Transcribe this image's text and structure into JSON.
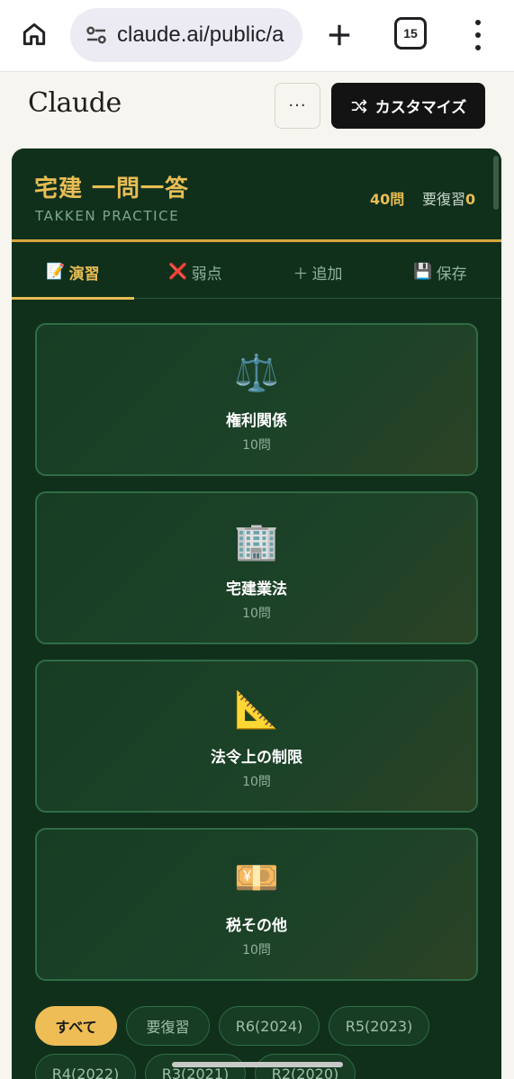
{
  "browser": {
    "url": "claude.ai/public/a",
    "tab_count": "15"
  },
  "claude": {
    "logo": "Claude",
    "more_label": "···",
    "customize_label": "カスタマイズ"
  },
  "app": {
    "title": "宅建 一問一答",
    "subtitle": "TAKKEN PRACTICE",
    "question_count": "40問",
    "review_label": "要復習",
    "review_count": "0",
    "tabs": [
      {
        "icon": "📝",
        "label": "演習"
      },
      {
        "icon": "❌",
        "label": "弱点"
      },
      {
        "icon": "＋",
        "label": "追加"
      },
      {
        "icon": "💾",
        "label": "保存"
      }
    ],
    "categories": [
      {
        "icon": "⚖️",
        "name": "権利関係",
        "count": "10問"
      },
      {
        "icon": "🏢",
        "name": "宅建業法",
        "count": "10問"
      },
      {
        "icon": "📐",
        "name": "法令上の制限",
        "count": "10問"
      },
      {
        "icon": "💴",
        "name": "税その他",
        "count": "10問"
      }
    ],
    "filters": [
      "すべて",
      "要復習",
      "R6(2024)",
      "R5(2023)",
      "R4(2022)",
      "R3(2021)",
      "R2(2020)"
    ]
  },
  "colors": {
    "accent": "#e9bd55",
    "app_bg": "#10301c",
    "card_border": "#2f6d45"
  }
}
